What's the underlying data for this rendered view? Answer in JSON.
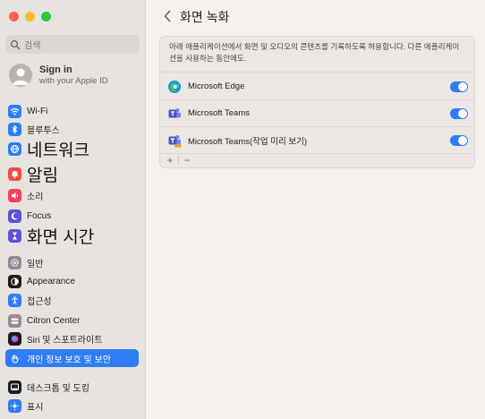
{
  "window": {
    "title": "화면 녹화"
  },
  "sidebar": {
    "search_placeholder": "검색",
    "account": {
      "title": "Sign in",
      "subtitle": "with your Apple ID"
    },
    "items": [
      {
        "label": "Wi-Fi",
        "icon": "wifi-icon",
        "color": "#2f7cf6"
      },
      {
        "label": "블루투스",
        "icon": "bluetooth-icon",
        "color": "#2f7cf6"
      },
      {
        "label": "네트워크",
        "icon": "globe-icon",
        "color": "#2f7cf6"
      },
      {
        "label": "알림",
        "icon": "bell-icon",
        "color": "#f44c43"
      },
      {
        "label": "소리",
        "icon": "speaker-icon",
        "color": "#f0445c"
      },
      {
        "label": "Focus",
        "icon": "moon-icon",
        "color": "#5b53d6"
      },
      {
        "label": "화면 시간",
        "icon": "hourglass-icon",
        "color": "#5b53d6"
      },
      {
        "label": "일반",
        "icon": "gear-icon",
        "color": "#8e8e93"
      },
      {
        "label": "Appearance",
        "icon": "appearance-icon",
        "color": "#1c1c1e"
      },
      {
        "label": "접근성",
        "icon": "accessibility-icon",
        "color": "#2f7cf6"
      },
      {
        "label": "Citron Center",
        "icon": "control-center-icon",
        "color": "#8e8e93"
      },
      {
        "label": "Siri 및 스포트라이트",
        "icon": "siri-icon",
        "color": "#1c1c1e"
      },
      {
        "label": "개인 정보 보호 및 보안",
        "icon": "hand-icon",
        "color": "#2f7cf6"
      },
      {
        "label": "데스크톱 및 도킹",
        "icon": "dock-icon",
        "color": "#1c1c1e"
      },
      {
        "label": "표시",
        "icon": "sun-icon",
        "color": "#2f7cf6"
      }
    ]
  },
  "main": {
    "description": "아래 애플리케이션에서 화면 및 오디오의 콘텐츠를 기록하도록 허용합니다. 다른 애플리케이션을 사용하는 동안에도.",
    "apps": [
      {
        "name": "Microsoft Edge",
        "icon": "edge-icon",
        "enabled": true
      },
      {
        "name": "Microsoft Teams",
        "icon": "teams-icon",
        "enabled": true
      },
      {
        "name": "Microsoft Teams(작업 미리 보기)",
        "icon": "teams-preview-icon",
        "enabled": true
      }
    ],
    "footer": {
      "add": "+",
      "remove": "−"
    }
  },
  "colors": {
    "accent": "#2e7cf6",
    "sidebar_bg": "#e7e3df",
    "window_bg": "#f3f0ed"
  }
}
